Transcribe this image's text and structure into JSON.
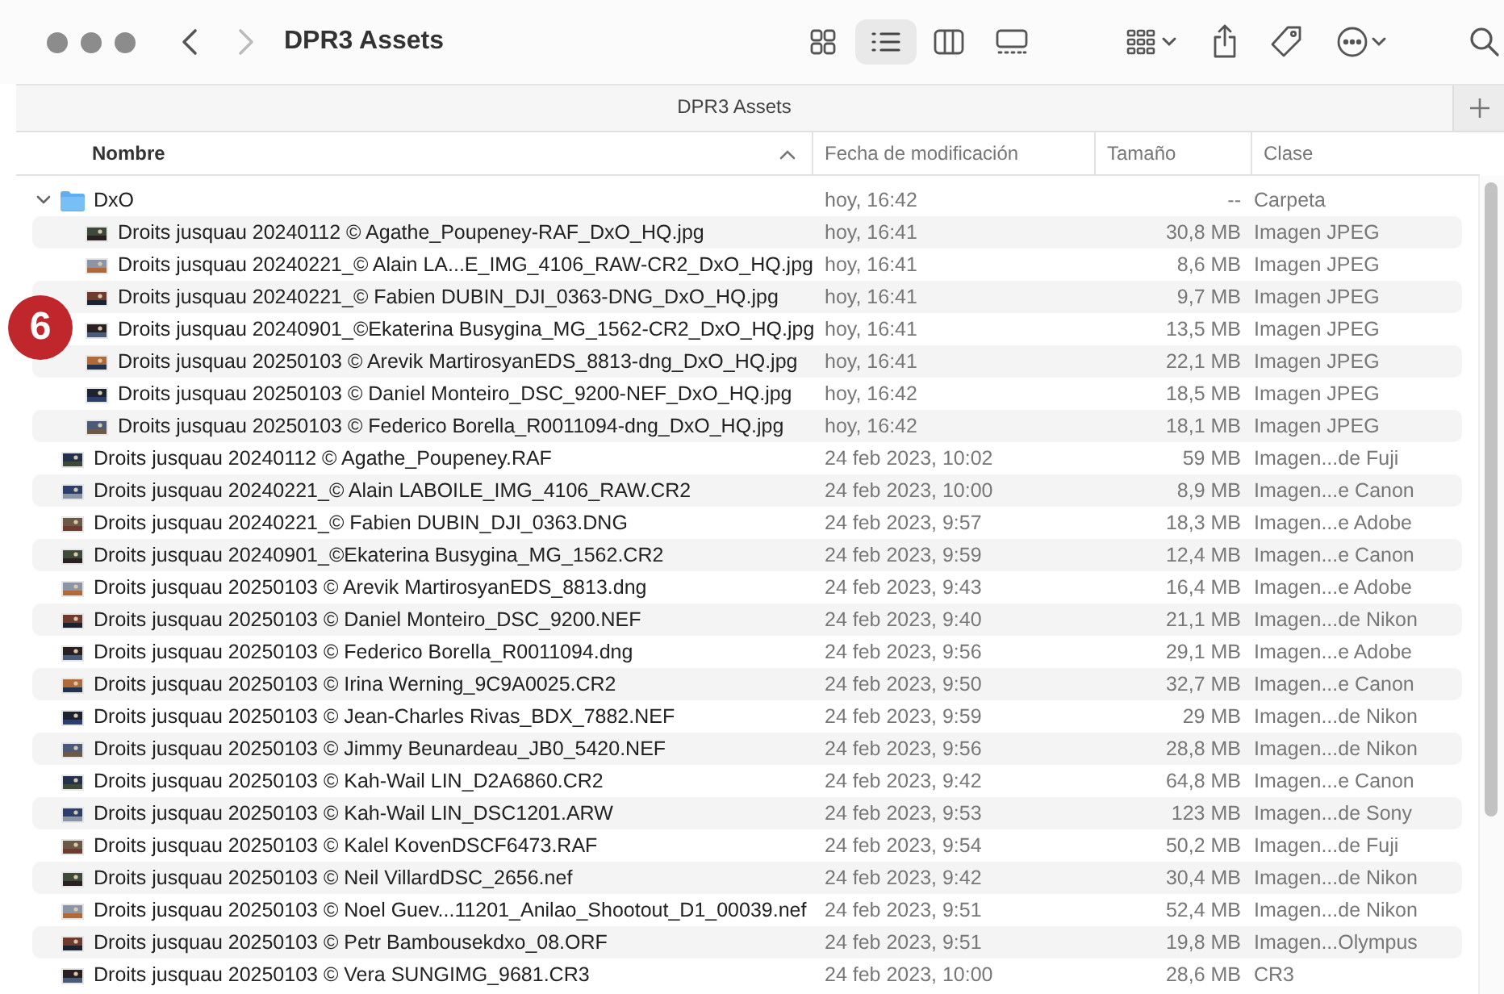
{
  "window": {
    "title": "DPR3 Assets"
  },
  "navigation": {
    "back_disabled": false,
    "forward_disabled": true
  },
  "view_modes": [
    {
      "kind": "icons",
      "selected": false
    },
    {
      "kind": "list",
      "selected": true
    },
    {
      "kind": "columns",
      "selected": false
    },
    {
      "kind": "gallery",
      "selected": false
    }
  ],
  "tabs": [
    {
      "label": "DPR3 Assets"
    }
  ],
  "columns": [
    {
      "label": "Nombre",
      "sorted": true
    },
    {
      "label": "Fecha de modificación",
      "sorted": false
    },
    {
      "label": "Tamaño",
      "sorted": false
    },
    {
      "label": "Clase",
      "sorted": false
    }
  ],
  "rows": [
    {
      "kind": "folder",
      "expanded": true,
      "name": "DxO",
      "modified": "hoy, 16:42",
      "size": "--",
      "type": "Carpeta",
      "children": [
        {
          "kind": "image",
          "name": "Droits jusquau 20240112 © Agathe_Poupeney-RAF_DxO_HQ.jpg",
          "modified": "hoy, 16:41",
          "size": "30,8 MB",
          "type": "Imagen JPEG"
        },
        {
          "kind": "image",
          "name": "Droits jusquau 20240221_© Alain LA...E_IMG_4106_RAW-CR2_DxO_HQ.jpg",
          "modified": "hoy, 16:41",
          "size": "8,6 MB",
          "type": "Imagen JPEG"
        },
        {
          "kind": "image",
          "name": "Droits jusquau 20240221_© Fabien DUBIN_DJI_0363-DNG_DxO_HQ.jpg",
          "modified": "hoy, 16:41",
          "size": "9,7 MB",
          "type": "Imagen JPEG"
        },
        {
          "kind": "image",
          "name": "Droits jusquau 20240901_©Ekaterina Busygina_MG_1562-CR2_DxO_HQ.jpg",
          "modified": "hoy, 16:41",
          "size": "13,5 MB",
          "type": "Imagen JPEG"
        },
        {
          "kind": "image",
          "name": "Droits jusquau 20250103 © Arevik MartirosyanEDS_8813-dng_DxO_HQ.jpg",
          "modified": "hoy, 16:41",
          "size": "22,1 MB",
          "type": "Imagen JPEG"
        },
        {
          "kind": "image",
          "name": "Droits jusquau 20250103 © Daniel Monteiro_DSC_9200-NEF_DxO_HQ.jpg",
          "modified": "hoy, 16:42",
          "size": "18,5 MB",
          "type": "Imagen JPEG"
        },
        {
          "kind": "image",
          "name": "Droits jusquau 20250103 © Federico Borella_R0011094-dng_DxO_HQ.jpg",
          "modified": "hoy, 16:42",
          "size": "18,1 MB",
          "type": "Imagen JPEG"
        }
      ]
    },
    {
      "kind": "image",
      "name": "Droits jusquau 20240112 © Agathe_Poupeney.RAF",
      "modified": "24 feb 2023, 10:02",
      "size": "59 MB",
      "type": "Imagen...de Fuji"
    },
    {
      "kind": "image",
      "name": "Droits jusquau 20240221_© Alain LABOILE_IMG_4106_RAW.CR2",
      "modified": "24 feb 2023, 10:00",
      "size": "8,9 MB",
      "type": "Imagen...e Canon"
    },
    {
      "kind": "image",
      "name": "Droits jusquau 20240221_© Fabien DUBIN_DJI_0363.DNG",
      "modified": "24 feb 2023, 9:57",
      "size": "18,3 MB",
      "type": "Imagen...e Adobe"
    },
    {
      "kind": "image",
      "name": "Droits jusquau 20240901_©Ekaterina Busygina_MG_1562.CR2",
      "modified": "24 feb 2023, 9:59",
      "size": "12,4 MB",
      "type": "Imagen...e Canon"
    },
    {
      "kind": "image",
      "name": "Droits jusquau 20250103 © Arevik MartirosyanEDS_8813.dng",
      "modified": "24 feb 2023, 9:43",
      "size": "16,4 MB",
      "type": "Imagen...e Adobe"
    },
    {
      "kind": "image",
      "name": "Droits jusquau 20250103 © Daniel Monteiro_DSC_9200.NEF",
      "modified": "24 feb 2023, 9:40",
      "size": "21,1 MB",
      "type": "Imagen...de Nikon"
    },
    {
      "kind": "image",
      "name": "Droits jusquau 20250103 © Federico Borella_R0011094.dng",
      "modified": "24 feb 2023, 9:56",
      "size": "29,1 MB",
      "type": "Imagen...e Adobe"
    },
    {
      "kind": "image",
      "name": "Droits jusquau 20250103 © Irina Werning_9C9A0025.CR2",
      "modified": "24 feb 2023, 9:50",
      "size": "32,7 MB",
      "type": "Imagen...e Canon"
    },
    {
      "kind": "image",
      "name": "Droits jusquau 20250103 © Jean-Charles Rivas_BDX_7882.NEF",
      "modified": "24 feb 2023, 9:59",
      "size": "29 MB",
      "type": "Imagen...de Nikon"
    },
    {
      "kind": "image",
      "name": "Droits jusquau 20250103 © Jimmy Beunardeau_JB0_5420.NEF",
      "modified": "24 feb 2023, 9:56",
      "size": "28,8 MB",
      "type": "Imagen...de Nikon"
    },
    {
      "kind": "image",
      "name": "Droits jusquau 20250103 © Kah-Wail LIN_D2A6860.CR2",
      "modified": "24 feb 2023, 9:42",
      "size": "64,8 MB",
      "type": "Imagen...e Canon"
    },
    {
      "kind": "image",
      "name": "Droits jusquau 20250103 © Kah-Wail LIN_DSC1201.ARW",
      "modified": "24 feb 2023, 9:53",
      "size": "123 MB",
      "type": "Imagen...de Sony"
    },
    {
      "kind": "image",
      "name": "Droits jusquau 20250103 © Kalel KovenDSCF6473.RAF",
      "modified": "24 feb 2023, 9:54",
      "size": "50,2 MB",
      "type": "Imagen...de Fuji"
    },
    {
      "kind": "image",
      "name": "Droits jusquau 20250103 © Neil VillardDSC_2656.nef",
      "modified": "24 feb 2023, 9:42",
      "size": "30,4 MB",
      "type": "Imagen...de Nikon"
    },
    {
      "kind": "image",
      "name": "Droits jusquau 20250103 © Noel Guev...11201_Anilao_Shootout_D1_00039.nef",
      "modified": "24 feb 2023, 9:51",
      "size": "52,4 MB",
      "type": "Imagen...de Nikon"
    },
    {
      "kind": "image",
      "name": "Droits jusquau 20250103 © Petr Bambousekdxo_08.ORF",
      "modified": "24 feb 2023, 9:51",
      "size": "19,8 MB",
      "type": "Imagen...Olympus"
    },
    {
      "kind": "image",
      "name": "Droits jusquau 20250103 © Vera SUNGIMG_9681.CR3",
      "modified": "24 feb 2023, 10:00",
      "size": "28,6 MB",
      "type": "CR3"
    }
  ],
  "annotation": {
    "label": "6"
  }
}
